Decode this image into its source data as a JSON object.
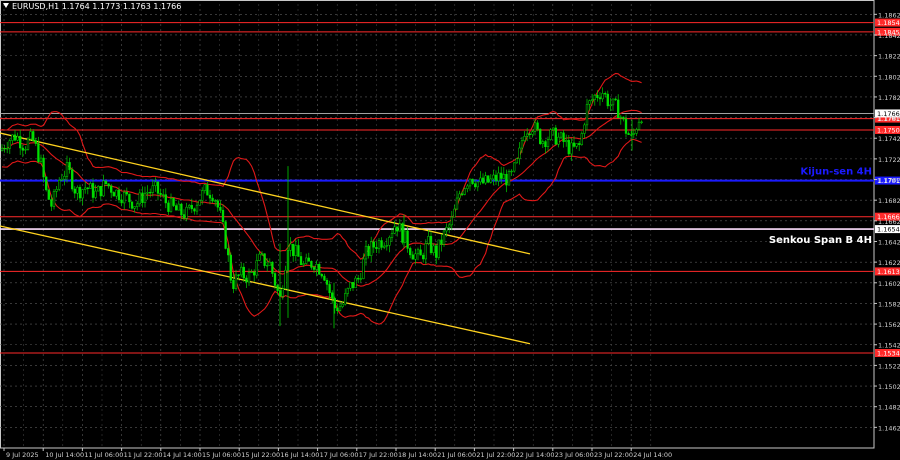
{
  "header": {
    "symbol_line": "EURUSD,H1  1.1764 1.1773 1.1763 1.1766"
  },
  "chart_data": {
    "type": "candlestick",
    "symbol": "EURUSD",
    "timeframe": "H1",
    "ohlc_text": "1.1764 1.1773 1.1763 1.1766",
    "current_price": 1.1766,
    "ylim": [
      1.1442,
      1.1872
    ],
    "y_ticks": [
      "1.1862",
      "1.1842",
      "1.1822",
      "1.1802",
      "1.1782",
      "1.1762",
      "1.1742",
      "1.1722",
      "1.1702",
      "1.1682",
      "1.1662",
      "1.1642",
      "1.1622",
      "1.1602",
      "1.1582",
      "1.1562",
      "1.1542",
      "1.1522",
      "1.1502",
      "1.1482",
      "1.1462"
    ],
    "x_ticks": [
      "9 Jul 2025",
      "10 Jul 14:00",
      "11 Jul 06:00",
      "11 Jul 22:00",
      "14 Jul 14:00",
      "15 Jul 06:00",
      "15 Jul 22:00",
      "16 Jul 14:00",
      "17 Jul 06:00",
      "17 Jul 22:00",
      "18 Jul 14:00",
      "21 Jul 06:00",
      "21 Jul 22:00",
      "22 Jul 14:00",
      "23 Jul 06:00",
      "23 Jul 22:00",
      "24 Jul 14:00"
    ],
    "horizontal_levels": [
      {
        "price": 1.1854,
        "label": "1.1854",
        "color": "#ff2a2a",
        "style": "red"
      },
      {
        "price": 1.1845,
        "label": "1.1845",
        "color": "#ff2a2a",
        "style": "red"
      },
      {
        "price": 1.175,
        "label": "1.1750",
        "color": "#ff2a2a",
        "style": "red"
      },
      {
        "price": 1.1761,
        "label": "1.1761",
        "color": "#ff2a2a",
        "style": "red"
      },
      {
        "price": 1.1766,
        "label": "1.1766",
        "color": "#ffffff",
        "style": "current"
      },
      {
        "price": 1.1701,
        "label": "1.1701",
        "color": "#1a1aff",
        "style": "kijun",
        "name": "Kijun-sen 4H"
      },
      {
        "price": 1.1666,
        "label": "1.1666",
        "color": "#ff2a2a",
        "style": "red"
      },
      {
        "price": 1.1654,
        "label": "1.1654",
        "color": "#ffe0ff",
        "style": "senkou",
        "name": "Senkou Span B 4H"
      },
      {
        "price": 1.1613,
        "label": "1.1613",
        "color": "#ff2a2a",
        "style": "red"
      },
      {
        "price": 1.1534,
        "label": "1.1534",
        "color": "#ff2a2a",
        "style": "red"
      }
    ],
    "level_labels": {
      "kijun": "Kijun-sen 4H",
      "senkou": "Senkou Span B 4H"
    },
    "trend_lines": [
      {
        "from": [
          0,
          1.1747
        ],
        "to": [
          530,
          1.163
        ],
        "color": "#ffd21e"
      },
      {
        "from": [
          0,
          1.1657
        ],
        "to": [
          530,
          1.1543
        ],
        "color": "#ffd21e"
      }
    ],
    "price_path": [
      [
        0,
        1.173
      ],
      [
        8,
        1.174
      ],
      [
        16,
        1.1745
      ],
      [
        24,
        1.1735
      ],
      [
        32,
        1.1742
      ],
      [
        40,
        1.1722
      ],
      [
        46,
        1.169
      ],
      [
        52,
        1.1676
      ],
      [
        60,
        1.1705
      ],
      [
        68,
        1.1712
      ],
      [
        76,
        1.169
      ],
      [
        86,
        1.1695
      ],
      [
        96,
        1.1688
      ],
      [
        106,
        1.1698
      ],
      [
        116,
        1.169
      ],
      [
        126,
        1.1685
      ],
      [
        136,
        1.1678
      ],
      [
        146,
        1.169
      ],
      [
        156,
        1.1692
      ],
      [
        166,
        1.168
      ],
      [
        176,
        1.1672
      ],
      [
        186,
        1.1668
      ],
      [
        196,
        1.168
      ],
      [
        206,
        1.1692
      ],
      [
        214,
        1.1688
      ],
      [
        220,
        1.1668
      ],
      [
        226,
        1.164
      ],
      [
        232,
        1.16
      ],
      [
        240,
        1.161
      ],
      [
        250,
        1.1608
      ],
      [
        260,
        1.1625
      ],
      [
        270,
        1.162
      ],
      [
        280,
        1.1585
      ],
      [
        288,
        1.164
      ],
      [
        296,
        1.163
      ],
      [
        304,
        1.1618
      ],
      [
        314,
        1.1622
      ],
      [
        324,
        1.1612
      ],
      [
        334,
        1.1578
      ],
      [
        342,
        1.158
      ],
      [
        350,
        1.1598
      ],
      [
        358,
        1.1605
      ],
      [
        366,
        1.163
      ],
      [
        376,
        1.164
      ],
      [
        386,
        1.1645
      ],
      [
        396,
        1.166
      ],
      [
        404,
        1.1646
      ],
      [
        412,
        1.1632
      ],
      [
        420,
        1.1625
      ],
      [
        428,
        1.164
      ],
      [
        436,
        1.163
      ],
      [
        444,
        1.1648
      ],
      [
        452,
        1.1662
      ],
      [
        460,
        1.169
      ],
      [
        470,
        1.1705
      ],
      [
        480,
        1.1698
      ],
      [
        490,
        1.17
      ],
      [
        500,
        1.1705
      ],
      [
        510,
        1.1702
      ],
      [
        518,
        1.172
      ],
      [
        524,
        1.175
      ],
      [
        532,
        1.1755
      ],
      [
        542,
        1.174
      ],
      [
        552,
        1.1745
      ],
      [
        562,
        1.174
      ],
      [
        572,
        1.173
      ],
      [
        580,
        1.1735
      ],
      [
        586,
        1.177
      ],
      [
        594,
        1.1782
      ],
      [
        602,
        1.1788
      ],
      [
        610,
        1.1775
      ],
      [
        618,
        1.177
      ],
      [
        626,
        1.175
      ],
      [
        632,
        1.174
      ],
      [
        638,
        1.176
      ],
      [
        642,
        1.1766
      ]
    ]
  }
}
